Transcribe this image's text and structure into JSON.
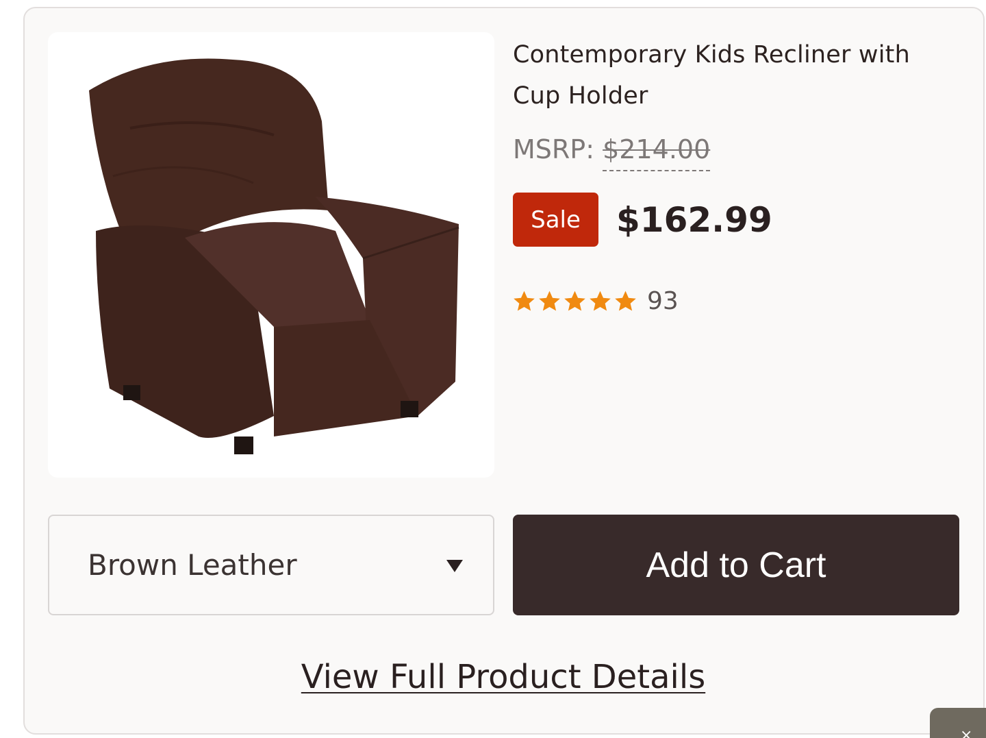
{
  "product": {
    "title": "Contemporary Kids Recliner with Cup Holder",
    "image_alt": "recliner-chair-photo",
    "msrp_label": "MSRP:",
    "msrp_price": "$214.00",
    "sale_badge": "Sale",
    "sale_price": "$162.99",
    "rating": {
      "stars": 5,
      "max": 5,
      "count": "93",
      "star_color": "#f08a11"
    },
    "variant": {
      "selected": "Brown Leather"
    },
    "add_to_cart_label": "Add to Cart",
    "details_link_label": "View Full Product Details"
  },
  "colors": {
    "sale_badge": "#c0280b",
    "add_to_cart_bg": "#382a2a",
    "chair": "#4a2a23"
  },
  "corner_widget": {
    "icon": "close-icon",
    "glyph": "×"
  }
}
